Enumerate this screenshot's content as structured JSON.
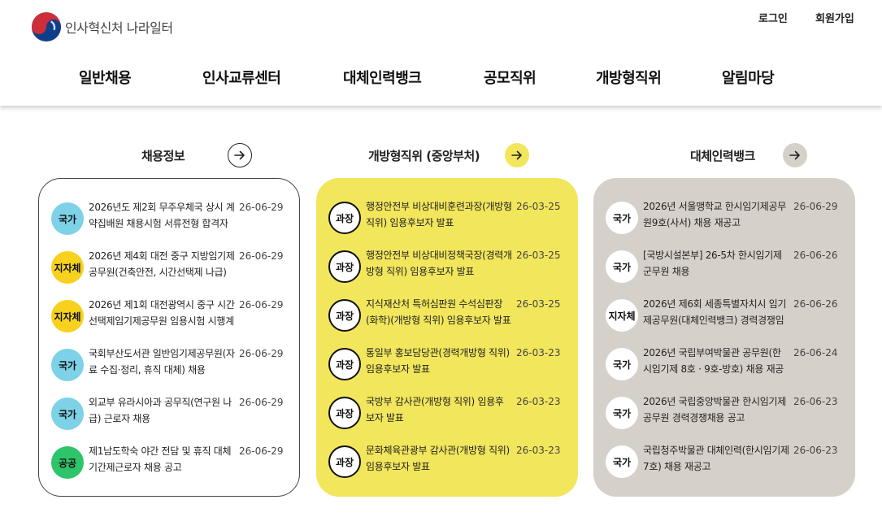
{
  "header": {
    "logo_text": "인사혁신처 나라일터",
    "login": "로그인",
    "signup": "회원가입"
  },
  "nav": [
    {
      "label": "일반채용"
    },
    {
      "label": "인사교류센터"
    },
    {
      "label": "대체인력뱅크"
    },
    {
      "label": "공모직위"
    },
    {
      "label": "개방형직위"
    },
    {
      "label": "알림마당"
    }
  ],
  "sections": {
    "recruit": {
      "title": "채용정보",
      "items": [
        {
          "badge": "국가",
          "badge_color": "#7dd2e8",
          "title": "2026년도 제2회 무주우체국 상시 계약집배원 채용시험 서류전형 합격자 발표",
          "date": "26-06-29"
        },
        {
          "badge": "지자체",
          "badge_color": "#f7d11e",
          "title": "2026년 제4회 대전 중구 지방임기제공무원(건축안전, 시간선택제 나급) 채용",
          "date": "26-06-29"
        },
        {
          "badge": "지자체",
          "badge_color": "#f7d11e",
          "title": "2026년 제1회 대전광역시 중구 시간선택제임기제공무원 임용시험 시행계획 공고",
          "date": "26-06-29"
        },
        {
          "badge": "국가",
          "badge_color": "#7dd2e8",
          "title": "국회부산도서관 일반임기제공무원(자료 수집·정리, 휴직 대체) 채용",
          "date": "26-06-29"
        },
        {
          "badge": "국가",
          "badge_color": "#7dd2e8",
          "title": "외교부 유라시아과 공무직(연구원 나급) 근로자 채용",
          "date": "26-06-29"
        },
        {
          "badge": "공공",
          "badge_color": "#2ec46a",
          "title": "제1남도학숙 야간 전담 및 휴직 대체 기간제근로자 채용 공고",
          "date": "26-06-29"
        }
      ]
    },
    "open": {
      "title": "개방형직위 (중앙부처)",
      "items": [
        {
          "badge": "과장",
          "title": "행정안전부 비상대비훈련과장(개방형 직위) 임용후보자 발표",
          "date": "26-03-25"
        },
        {
          "badge": "과장",
          "title": "행정안전부 비상대비정책국장(경력개방형 직위) 임용후보자 발표",
          "date": "26-03-25"
        },
        {
          "badge": "과장",
          "title": "지식재산처 특허심판원 수석심판장(화학)(개방형 직위) 임용후보자 발표",
          "date": "26-03-25"
        },
        {
          "badge": "과장",
          "title": "통일부 홍보담당관(경력개방형 직위) 임용후보자 발표",
          "date": "26-03-23"
        },
        {
          "badge": "과장",
          "title": "국방부 감사관(개방형 직위) 임용후보자 발표",
          "date": "26-03-23"
        },
        {
          "badge": "과장",
          "title": "문화체육관광부 감사관(개방형 직위) 임용후보자 발표",
          "date": "26-03-23"
        }
      ]
    },
    "substitute": {
      "title": "대체인력뱅크",
      "items": [
        {
          "badge": "국가",
          "title": "2026년 서울맹학교 한시임기제공무원9호(사서) 채용 재공고",
          "date": "26-06-29"
        },
        {
          "badge": "국가",
          "title": "[국방시설본부] 26-5차 한시임기제군무원 채용",
          "date": "26-06-26"
        },
        {
          "badge": "지자체",
          "title": "2026년 제6회 세종특별자치시 임기제공무원(대체인력뱅크) 경력경쟁임용시험 공고",
          "date": "26-06-26"
        },
        {
          "badge": "국가",
          "title": "2026년 국립부여박물관 공무원(한시임기제 8호 · 9호-방호) 채용 재공고",
          "date": "26-06-24"
        },
        {
          "badge": "국가",
          "title": "2026년 국립중앙박물관 한시임기제 공무원 경력경쟁채용 공고",
          "date": "26-06-23"
        },
        {
          "badge": "국가",
          "title": "국립청주박물관 대체인력(한시임기제 7호) 채용 재공고",
          "date": "26-06-23"
        }
      ]
    }
  }
}
